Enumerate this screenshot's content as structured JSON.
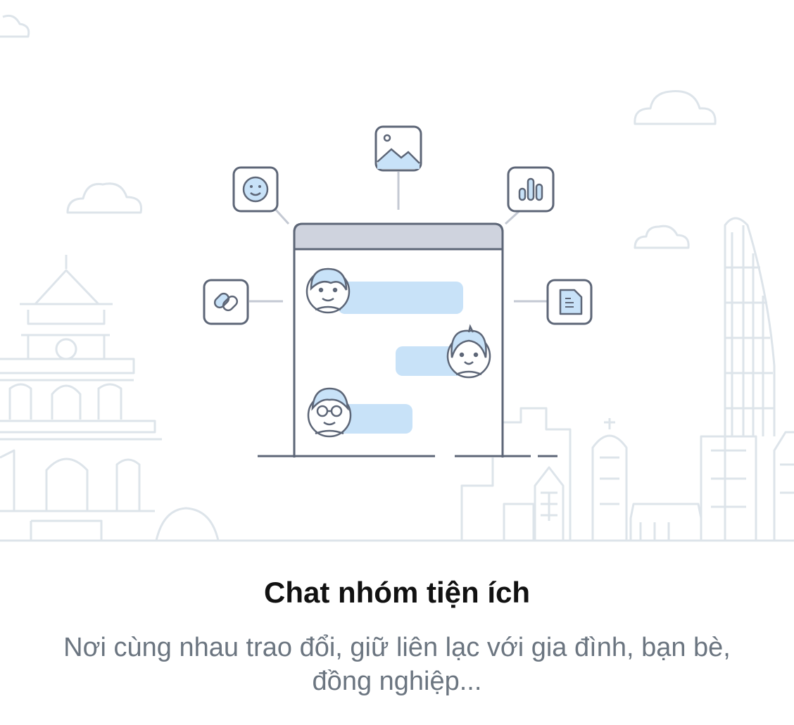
{
  "onboarding": {
    "title": "Chat nhóm tiện ích",
    "description": "Nơi cùng nhau trao đổi, giữ liên lạc với gia đình, bạn bè, đồng nghiệp..."
  },
  "illustration": {
    "icons": [
      "emoji-icon",
      "image-icon",
      "chart-icon",
      "link-icon",
      "document-icon"
    ],
    "avatars": [
      "avatar-boy",
      "avatar-girl",
      "avatar-glasses"
    ]
  },
  "colors": {
    "outline": "#5d6677",
    "bubble": "#c8e2f8",
    "header_bar": "#cfd3de",
    "skyline": "#dde4ea",
    "title": "#111111",
    "description": "#6b7580"
  }
}
